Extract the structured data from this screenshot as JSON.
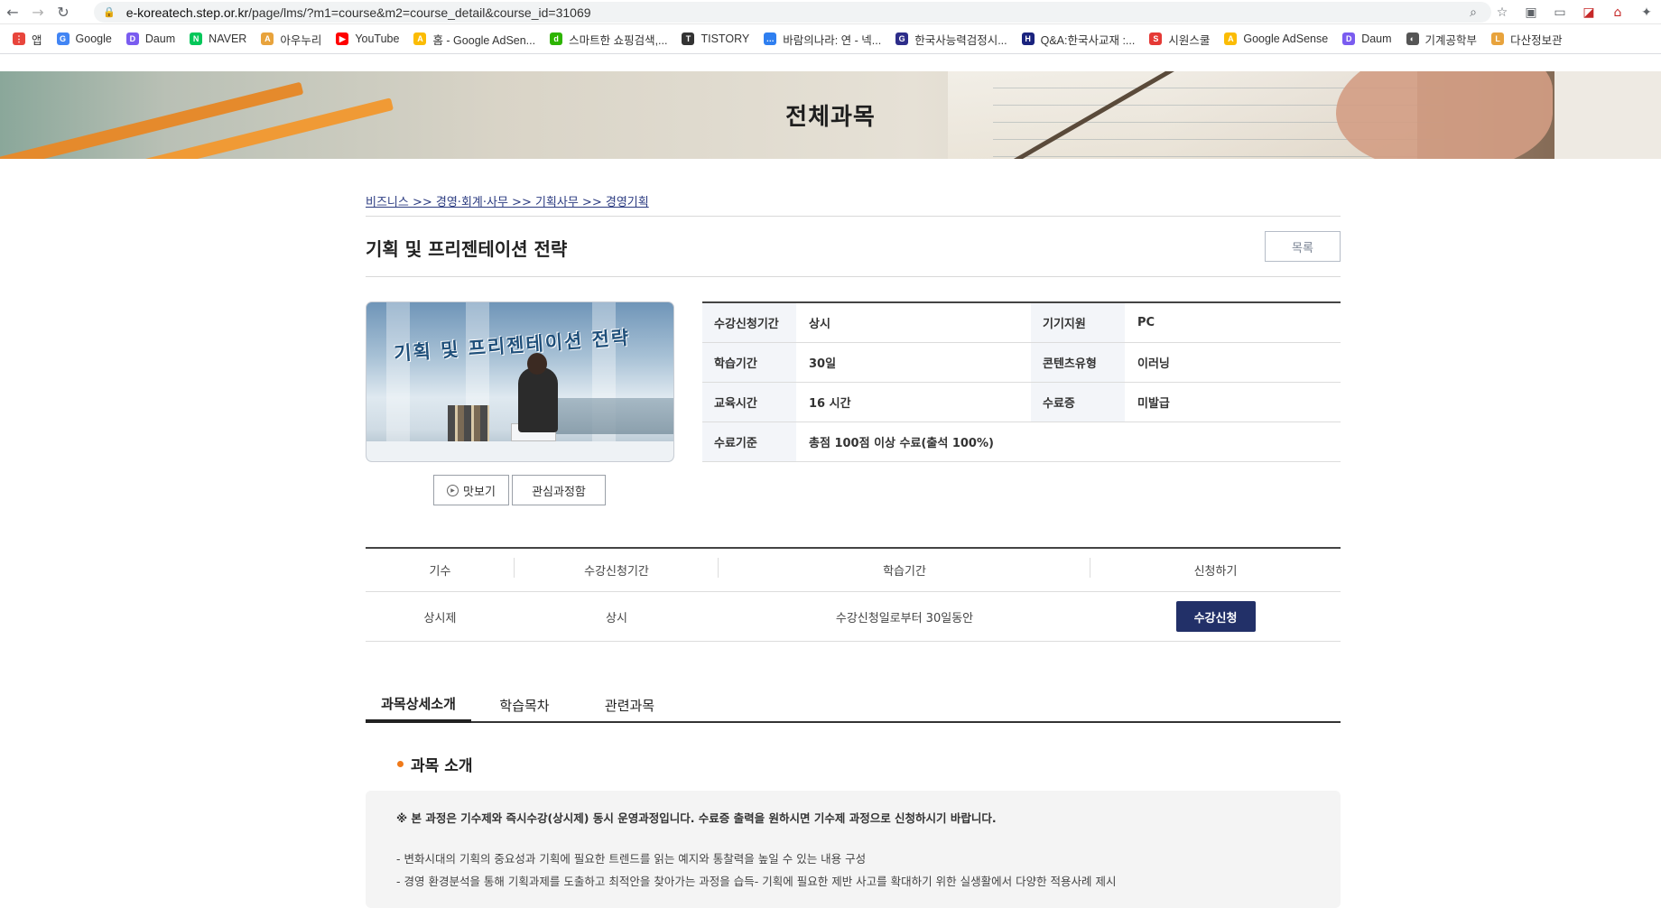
{
  "browser": {
    "url_domain": "e-koreatech.step.or.kr",
    "url_path": "/page/lms/?m1=course&m2=course_detail&course_id=31069"
  },
  "bookmarks": [
    {
      "label": "앱",
      "icon": "apps-grid-icon",
      "color": "#e8453c"
    },
    {
      "label": "Google",
      "icon": "google-icon",
      "color": "#4285f4"
    },
    {
      "label": "Daum",
      "icon": "daum-icon",
      "color": "#7a5cf0"
    },
    {
      "label": "NAVER",
      "icon": "naver-icon",
      "color": "#03c75a"
    },
    {
      "label": "아우누리",
      "icon": "auri-icon",
      "color": "#e8a33c"
    },
    {
      "label": "YouTube",
      "icon": "youtube-icon",
      "color": "#ff0000"
    },
    {
      "label": "홈 - Google AdSen...",
      "icon": "adsense-icon",
      "color": "#fbbc04"
    },
    {
      "label": "스마트한 쇼핑검색,...",
      "icon": "danawa-icon",
      "color": "#2db400"
    },
    {
      "label": "TISTORY",
      "icon": "tistory-icon",
      "color": "#333333"
    },
    {
      "label": "바람의나라: 연 - 넥...",
      "icon": "nexon-icon",
      "color": "#2f7ff0"
    },
    {
      "label": "한국사능력검정시...",
      "icon": "gsc-icon",
      "color": "#2d2d8a"
    },
    {
      "label": "Q&A:한국사교재 :...",
      "icon": "h-icon",
      "color": "#1a237e"
    },
    {
      "label": "시원스쿨",
      "icon": "siwon-icon",
      "color": "#e53935"
    },
    {
      "label": "Google AdSense",
      "icon": "adsense-icon",
      "color": "#fbbc04"
    },
    {
      "label": "Daum",
      "icon": "daum-icon",
      "color": "#7a5cf0"
    },
    {
      "label": "기계공학부",
      "icon": "globe-icon",
      "color": "#555555"
    },
    {
      "label": "다산정보관",
      "icon": "library-icon",
      "color": "#e8a33c"
    }
  ],
  "banner": {
    "title": "전체과목"
  },
  "breadcrumb": "비즈니스 >> 경영·회계·사무 >> 기획사무 >> 경영기획",
  "course": {
    "title": "기획 및 프리젠테이션 전략",
    "list_button": "목록",
    "thumbnail_text": "기획 및 프리젠테이션 전략",
    "preview_button": "맛보기",
    "interest_button": "관심과정함"
  },
  "info": {
    "rows": [
      {
        "k1": "수강신청기간",
        "v1": "상시",
        "k2": "기기지원",
        "v2": "PC"
      },
      {
        "k1": "학습기간",
        "v1": "30일",
        "k2": "콘텐츠유형",
        "v2": "이러닝"
      },
      {
        "k1": "교육시간",
        "v1": "16 시간",
        "k2": "수료증",
        "v2": "미발급"
      }
    ],
    "criteria_key": "수료기준",
    "criteria_value": "총점 100점 이상 수료(출석 100%)"
  },
  "rounds": {
    "headers": [
      "기수",
      "수강신청기간",
      "학습기간",
      "신청하기"
    ],
    "row": {
      "round": "상시제",
      "period": "상시",
      "study": "수강신청일로부터 30일동안",
      "apply": "수강신청"
    }
  },
  "tabs": [
    "과목상세소개",
    "학습목차",
    "관련과목"
  ],
  "section": {
    "title": "과목 소개",
    "notice": "※ 본 과정은 기수제와 즉시수강(상시제) 동시 운영과정입니다. 수료증 출력을 원하시면 기수제 과정으로 신청하시기 바랍니다.",
    "lines": [
      "- 변화시대의 기획의 중요성과 기획에 필요한 트렌드를 읽는 예지와 통찰력을 높일 수 있는 내용 구성",
      "- 경영 환경분석을 통해 기획과제를 도출하고 최적안을 찾아가는 과정을 습득- 기획에 필요한 제반 사고를 확대하기 위한 실생활에서 다양한 적용사례 제시"
    ]
  },
  "colors": {
    "accent": "#223068",
    "orange_dot": "#f07a1a"
  }
}
